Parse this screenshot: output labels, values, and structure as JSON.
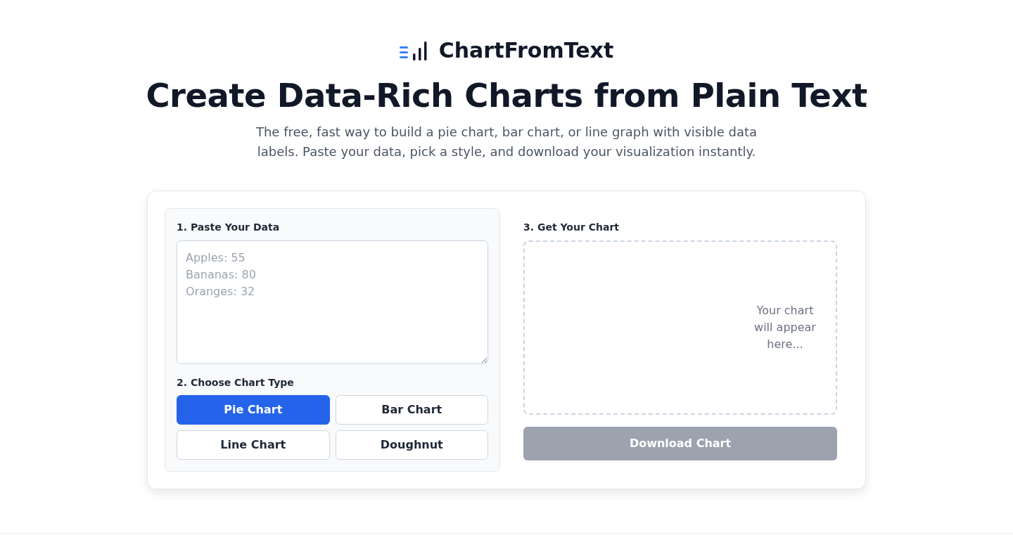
{
  "header": {
    "logo": "ChartFromText",
    "title": "Create Data-Rich Charts from Plain Text",
    "subtitle": "The free, fast way to build a pie chart, bar chart, or line graph with visible data labels. Paste your data, pick a style, and download your visualization instantly."
  },
  "input": {
    "label": "1. Paste Your Data",
    "placeholder": "Apples: 55\nBananas: 80\nOranges: 32"
  },
  "chart_type": {
    "label": "2. Choose Chart Type",
    "options": [
      {
        "label": "Pie Chart",
        "selected": true
      },
      {
        "label": "Bar Chart",
        "selected": false
      },
      {
        "label": "Line Chart",
        "selected": false
      },
      {
        "label": "Doughnut",
        "selected": false
      }
    ]
  },
  "output": {
    "label": "3. Get Your Chart",
    "preview_message": "Your chart will appear here...",
    "download_button": {
      "label": "Download Chart",
      "disabled": true
    }
  }
}
